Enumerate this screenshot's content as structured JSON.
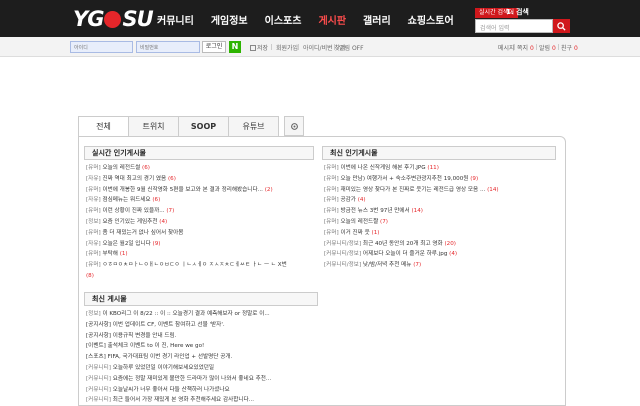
{
  "header": {
    "logo": "YGOSU",
    "nav": [
      "커뮤니티",
      "게임정보",
      "이스포츠",
      "게시판",
      "갤러리",
      "쇼핑스토어"
    ],
    "active_nav_index": 3,
    "rank_badge": "실시간 검색어",
    "rank_text": "1. 검색",
    "search_placeholder": "검색어 입력"
  },
  "subbar": {
    "id_placeholder": "아이디",
    "pw_placeholder": "비밀번호",
    "login_label": "로그인",
    "naver_label": "N",
    "keep_login": "저장",
    "links": [
      "회원가입",
      "아이디/비번 찾기",
      "알림 OFF"
    ],
    "right": [
      {
        "label": "메시지",
        "count": ""
      },
      {
        "label": "쪽지",
        "count": "0"
      },
      {
        "label": "알림",
        "count": "0"
      },
      {
        "label": "친구",
        "count": "0"
      }
    ]
  },
  "tabs": [
    "전체",
    "트위치",
    "SOOP",
    "유튜브"
  ],
  "active_tab": 0,
  "sections": {
    "left_top": {
      "title": "실시간 인기게시물",
      "items": [
        {
          "cat": "[유머]",
          "text": "오늘의 레전드썰",
          "n": "(6)"
        },
        {
          "cat": "[자유]",
          "text": "진짜 역대 최고의 경기 였음",
          "n": "(6)"
        },
        {
          "cat": "[유머]",
          "text": "이번에 개봉한 9월 신작영화 5편을 보고와 본 결과 정리해봤습니다...",
          "n": "(2)"
        },
        {
          "cat": "[자유]",
          "text": "점심메뉴는 뭐드세요",
          "n": "(6)"
        },
        {
          "cat": "[유머]",
          "text": "이런 상황이 진짜 있을까...",
          "n": "(7)"
        },
        {
          "cat": "[정보]",
          "text": "요즘 인기있는 게임추천",
          "n": "(4)"
        },
        {
          "cat": "[유머]",
          "text": "좀 더 재밌는거 없나 싶어서 찾아봄",
          "n": ""
        },
        {
          "cat": "[자유]",
          "text": "오늘은 월2일 입니다",
          "n": "(9)"
        },
        {
          "cat": "[유머]",
          "text": "부탁해",
          "n": "(1)"
        },
        {
          "cat": "[유머]",
          "text": "ㅇㅎㅁㅇㅊㅁㅏㄴㅇㅐㄴㅇㅂㄷㅇ ㅣㄴㅅㅔㅇ ㅈㅅㅈㅊㄷㅔㅆㅌ ㅏㄴ ㅡ ㄴ X번",
          "n": ""
        },
        {
          "cat": "",
          "text": "",
          "n": "(8)"
        }
      ]
    },
    "right_top": {
      "title": "최신 인기게시물",
      "items": [
        {
          "cat": "[유머]",
          "text": "이번에 나온 신작게임 해본 후기.JPG",
          "n": "(11)"
        },
        {
          "cat": "[유머]",
          "text": "오늘 만남) 여행가서 + 숙소주변관광지추천 19,000원",
          "n": "(9)"
        },
        {
          "cat": "[유머]",
          "text": "재미있는 영상 찾다가 본 진짜로 웃기는 레전드급 영상 모음 ...",
          "n": "(14)"
        },
        {
          "cat": "[유머]",
          "text": "공감가",
          "n": "(4)"
        },
        {
          "cat": "[유머]",
          "text": "방금전 뉴스 3번 97년 만에서",
          "n": "(14)"
        },
        {
          "cat": "[유머]",
          "text": "오늘의 레전드짤",
          "n": "(7)"
        },
        {
          "cat": "[유머]",
          "text": "이거 진짜 웃",
          "n": "(1)"
        },
        {
          "cat": "[커뮤니티/정보]",
          "text": "최근 40년 동안의 20개 최고 영화",
          "n": "(20)"
        },
        {
          "cat": "[커뮤니티/정보]",
          "text": "어제보다 오늘이 더 즐거운 하루.jpg",
          "n": "(4)"
        },
        {
          "cat": "[커뮤니티/정보]",
          "text": "낮/밤/저녁 추천 메뉴",
          "n": "(7)"
        }
      ]
    },
    "left_bottom": {
      "title": "최신 게시물",
      "items": [
        {
          "cat": "[정보]",
          "text": "이 KBO리그 이 8/22 :: 이 :: 오늘경기 결과 예측해보자 or 정말로 이...",
          "n": ""
        },
        {
          "cat": "",
          "text": "[공지사항] 이번 업데이트 CF, 이벤트 참여하고 선물 '받자'.",
          "n": ""
        },
        {
          "cat": "",
          "text": "[공지사항] 이용규칙 변경을 안내 드림.",
          "n": ""
        },
        {
          "cat": "",
          "text": "[이벤트] 출석체크 이벤트 to 이 진, Here we go!",
          "n": ""
        },
        {
          "cat": "",
          "text": "[스포츠] FIFA, 국가대표팀 이번 경기 라인업 + 선발명단 공개.",
          "n": ""
        },
        {
          "cat": "[커뮤니티]",
          "text": "오늘하루 있었던일 이야기해보세요있었던일",
          "n": ""
        },
        {
          "cat": "[커뮤니티]",
          "text": "요즘에는 정말 재미있게 볼만한 드라마가 많이 나와서 좋네요 추천...",
          "n": ""
        },
        {
          "cat": "[커뮤니티]",
          "text": "오늘날씨가 너무 좋아서 다들 산책하러 나가셨나요",
          "n": ""
        },
        {
          "cat": "[커뮤니티]",
          "text": "최근 들어서 가장 재밌게 본 영화 추천해주세요 감사합니다...",
          "n": ""
        }
      ]
    }
  },
  "colors": {
    "topbar": "#1d1d1d",
    "accent": "#d0181c",
    "active_nav": "#ff4d4d",
    "naver": "#2db400"
  }
}
